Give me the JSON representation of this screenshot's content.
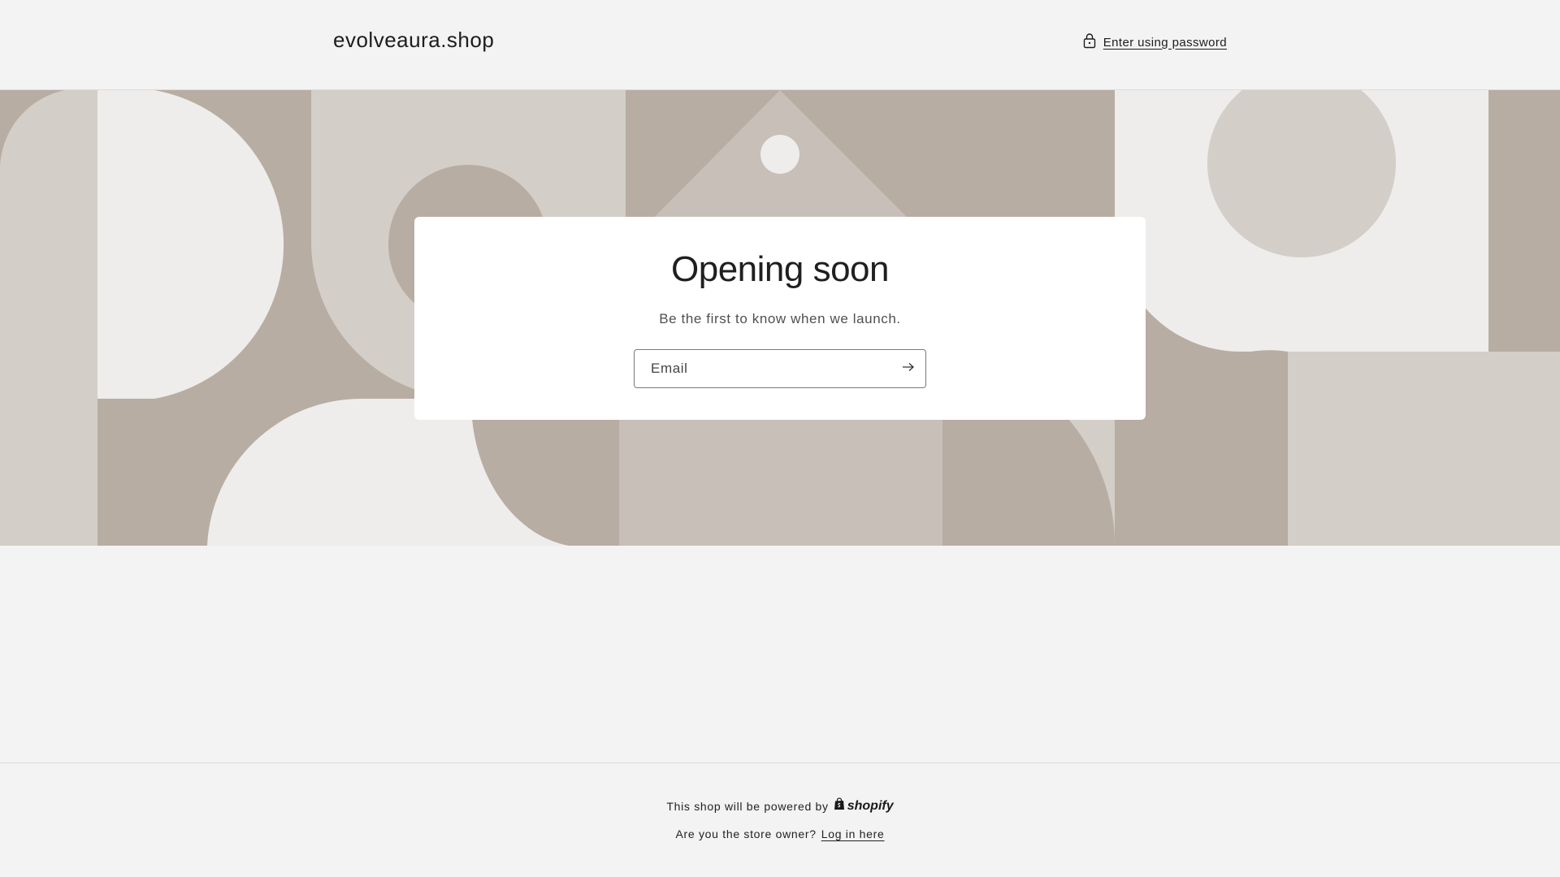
{
  "header": {
    "logo": "evolveaura.shop",
    "password_link": "Enter using password"
  },
  "hero": {
    "title": "Opening soon",
    "subtitle": "Be the first to know when we launch.",
    "email_placeholder": "Email"
  },
  "footer": {
    "powered_text": "This shop will be powered by",
    "powered_brand": "shopify",
    "owner_text": "Are you the store owner?",
    "login_link": "Log in here"
  },
  "colors": {
    "page_bg": "#f3f3f3",
    "banner_dark": "#b7ada2",
    "banner_mid": "#c7bfb8",
    "banner_light": "#d3cec8",
    "banner_lightest": "#eeedeb",
    "card_bg": "#ffffff"
  },
  "icons": {
    "password": "lock-icon",
    "submit": "arrow-right-icon",
    "brand": "shopify-bag-icon"
  }
}
